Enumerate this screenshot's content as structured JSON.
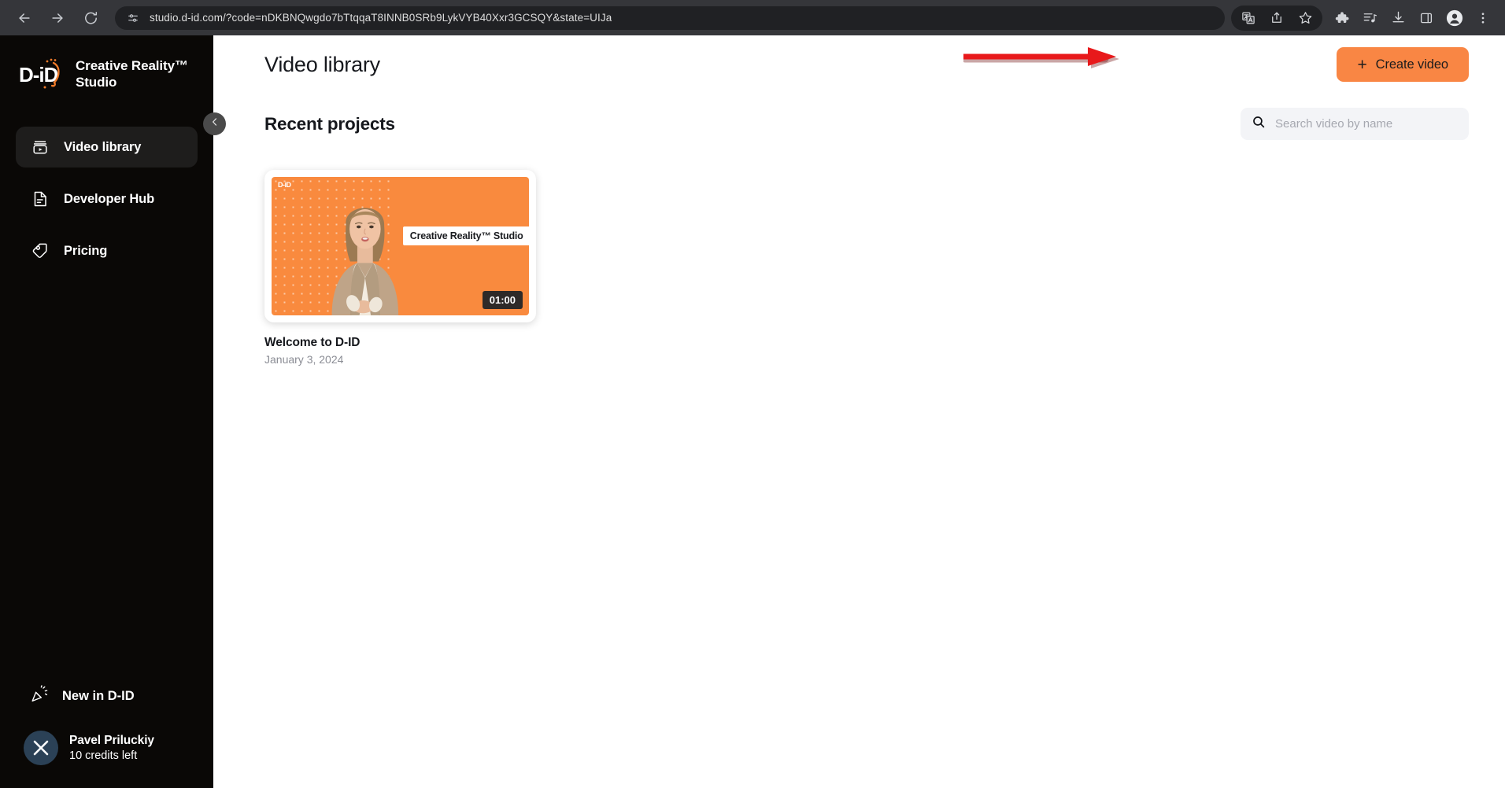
{
  "browser": {
    "back_label": "Back",
    "forward_label": "Forward",
    "reload_label": "Reload",
    "site_settings_icon": "tune-icon",
    "url": "studio.d-id.com/?code=nDKBNQwgdo7bTtqqaT8INNB0SRb9LykVYB40Xxr3GCSQY&state=UIJa",
    "toolbar_icons": [
      {
        "name": "translate-icon",
        "label": "Translate this page"
      },
      {
        "name": "share-icon",
        "label": "Share this page"
      },
      {
        "name": "bookmark-star-icon",
        "label": "Bookmark this tab"
      },
      {
        "name": "extensions-puzzle-icon",
        "label": "Extensions"
      },
      {
        "name": "media-playlist-icon",
        "label": "Media controls"
      },
      {
        "name": "download-icon",
        "label": "Downloads"
      },
      {
        "name": "side-panel-icon",
        "label": "Side panel"
      },
      {
        "name": "profile-avatar-icon",
        "label": "Profile"
      },
      {
        "name": "kebab-menu-icon",
        "label": "Customize and control"
      }
    ]
  },
  "sidebar": {
    "brand": {
      "logo_name": "d-id-logo",
      "logo_text": "D-iD",
      "title_line1": "Creative Reality™",
      "title_line2": "Studio"
    },
    "collapse_button": {
      "name": "sidebar-collapse-button",
      "icon": "chevron-left-icon"
    },
    "items": [
      {
        "label": "Video library",
        "icon": "video-library-icon",
        "active": true
      },
      {
        "label": "Developer Hub",
        "icon": "document-icon",
        "active": false
      },
      {
        "label": "Pricing",
        "icon": "price-tag-icon",
        "active": false
      }
    ],
    "whats_new": {
      "label": "New in D-ID",
      "icon": "party-popper-icon"
    },
    "user": {
      "name": "Pavel Priluckiy",
      "credits": "10 credits left",
      "avatar_glyph": "X",
      "avatar_color": "#2b4156"
    }
  },
  "main": {
    "page_title": "Video library",
    "create_button": {
      "label": "Create video",
      "plus": "+",
      "color": "#f98644"
    },
    "section_title": "Recent projects",
    "search": {
      "icon": "search-icon",
      "placeholder": "Search video by name",
      "value": ""
    },
    "projects": [
      {
        "title": "Welcome to D-ID",
        "date": "January 3, 2024",
        "duration": "01:00",
        "thumb_label": "Creative Reality™ Studio",
        "thumb_watermark": "D-iD",
        "thumb_bg": "#f98a3e"
      }
    ]
  },
  "annotation": {
    "arrow": {
      "name": "red-arrow-annotation",
      "color": "#e8191b",
      "points_to": "create-video-button"
    }
  }
}
